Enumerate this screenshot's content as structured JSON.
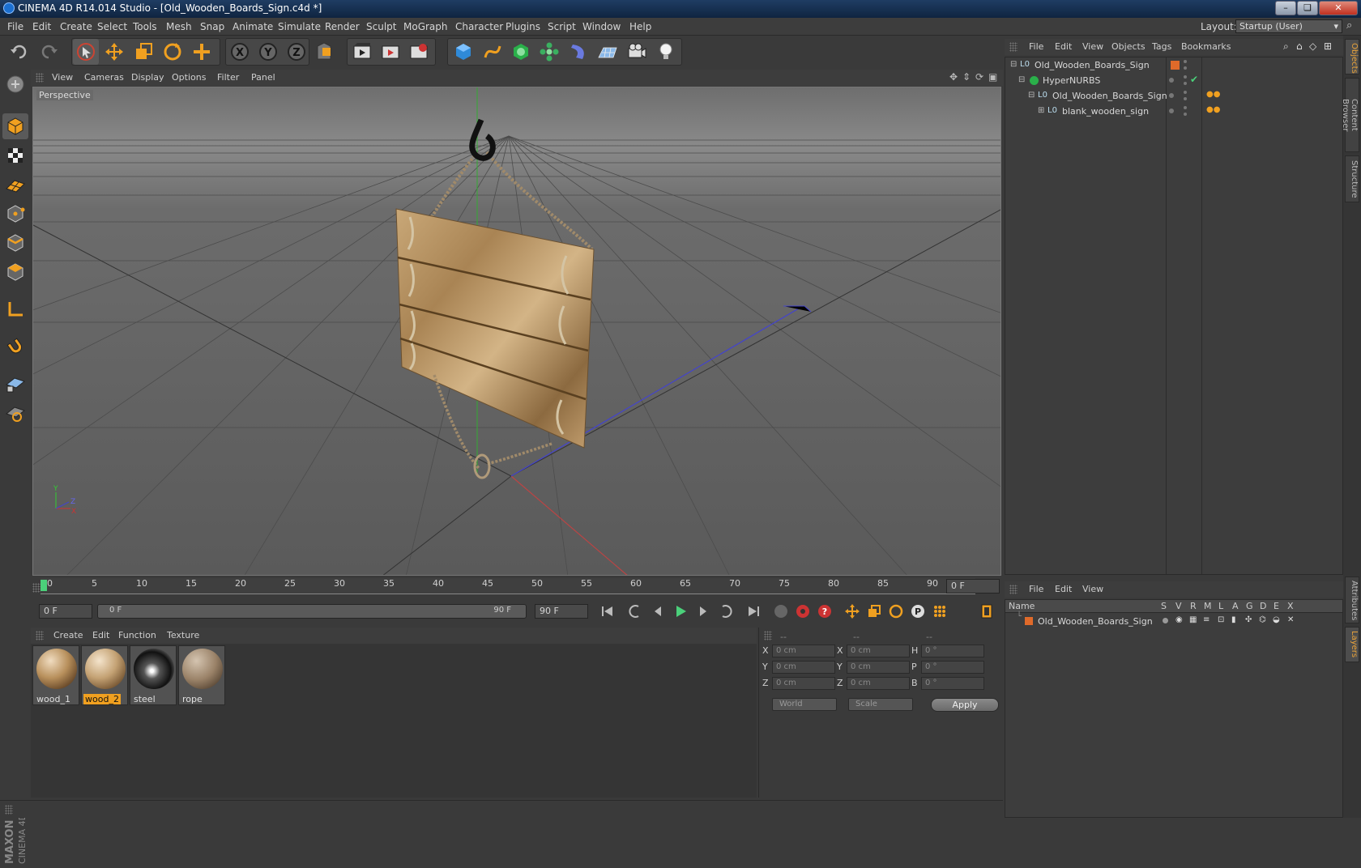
{
  "window": {
    "title": "CINEMA 4D R14.014 Studio - [Old_Wooden_Boards_Sign.c4d *]",
    "controls": [
      "–",
      "❏",
      "✕"
    ]
  },
  "menu": [
    "File",
    "Edit",
    "Create",
    "Select",
    "Tools",
    "Mesh",
    "Snap",
    "Animate",
    "Simulate",
    "Render",
    "Sculpt",
    "MoGraph",
    "Character",
    "Plugins",
    "Script",
    "Window",
    "Help"
  ],
  "layout": {
    "label": "Layout:",
    "value": "Startup (User)"
  },
  "toolbar": {
    "icons": [
      "undo-icon",
      "redo-icon",
      "live-selection-icon",
      "move-icon",
      "scale-icon",
      "rotate-icon",
      "add-icon",
      "x-axis-icon",
      "y-axis-icon",
      "z-axis-icon",
      "coordinate-system-icon",
      "render-view-icon",
      "render-picture-viewer-icon",
      "edit-render-settings-icon",
      "cube-icon",
      "spline-icon",
      "nurbs-icon",
      "array-icon",
      "deformer-icon",
      "floor-icon",
      "camera-icon",
      "light-icon"
    ]
  },
  "viewport": {
    "menu": [
      "View",
      "Cameras",
      "Display",
      "Options",
      "Filter",
      "Panel"
    ],
    "label": "Perspective",
    "axis_labels": {
      "y": "Y",
      "z": "Z",
      "x": "X"
    }
  },
  "timeline": {
    "ticks": [
      "0",
      "5",
      "10",
      "15",
      "20",
      "25",
      "30",
      "35",
      "40",
      "45",
      "50",
      "55",
      "60",
      "65",
      "70",
      "75",
      "80",
      "85",
      "90"
    ],
    "end_field": "0 F"
  },
  "transport": {
    "current_frame": "0 F",
    "range_start": "0 F",
    "range_end": "90 F",
    "max_frame": "90 F"
  },
  "materials": {
    "menu": [
      "Create",
      "Edit",
      "Function",
      "Texture"
    ],
    "items": [
      {
        "name": "wood_1",
        "selected": false
      },
      {
        "name": "wood_2",
        "selected": true
      },
      {
        "name": "steel",
        "selected": false
      },
      {
        "name": "rope",
        "selected": false
      }
    ]
  },
  "coordinates": {
    "headers": [
      "--",
      "--",
      "--"
    ],
    "rows": [
      {
        "l1": "X",
        "v1": "0 cm",
        "l2": "X",
        "v2": "0 cm",
        "l3": "H",
        "v3": "0 °"
      },
      {
        "l1": "Y",
        "v1": "0 cm",
        "l2": "Y",
        "v2": "0 cm",
        "l3": "P",
        "v3": "0 °"
      },
      {
        "l1": "Z",
        "v1": "0 cm",
        "l2": "Z",
        "v2": "0 cm",
        "l3": "B",
        "v3": "0 °"
      }
    ],
    "world": "World",
    "scale": "Scale",
    "apply": "Apply"
  },
  "objects": {
    "menu": [
      "File",
      "Edit",
      "View",
      "Objects",
      "Tags",
      "Bookmarks"
    ],
    "items": [
      {
        "name": "Old_Wooden_Boards_Sign"
      },
      {
        "name": "HyperNURBS"
      },
      {
        "name": "Old_Wooden_Boards_Sign"
      },
      {
        "name": "blank_wooden_sign"
      }
    ]
  },
  "layers": {
    "menu": [
      "File",
      "Edit",
      "View"
    ],
    "columns": [
      "Name",
      "S",
      "V",
      "R",
      "M",
      "L",
      "A",
      "G",
      "D",
      "E",
      "X"
    ],
    "items": [
      {
        "name": "Old_Wooden_Boards_Sign",
        "color": "#e06a2a"
      }
    ]
  },
  "right_tabs": [
    "Objects",
    "Content Browser",
    "Structure",
    "Attributes",
    "Layers"
  ],
  "brand": {
    "line1": "MAXON",
    "line2": "CINEMA 4D"
  },
  "colors": {
    "accent": "#e8a23a",
    "selection": "#f0a020",
    "background": "#3a3a3a"
  }
}
